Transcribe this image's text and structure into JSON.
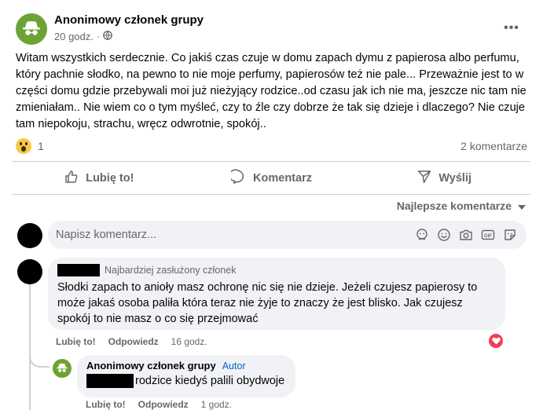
{
  "post": {
    "author": "Anonimowy członek grupy",
    "time": "20 godz.",
    "more": "•••",
    "text": "Witam wszystkich serdecznie. Co jakiś czas czuje w domu zapach dymu z papierosa albo perfumu, który pachnie słodko, na pewno  to nie moje perfumy, papierosów też nie pale... Przeważnie jest to w części domu gdzie przebywali moi już nieżyjący rodzice..od czasu jak ich nie ma, jeszcze nic tam nie zmieniałam.. Nie wiem co o tym myśleć, czy to źle czy dobrze że tak się dzieje i dlaczego? Nie czuje tam niepokoju, strachu, wręcz odwrotnie, spokój..",
    "reactions_count": "1",
    "comments_count": "2 komentarze"
  },
  "actions": {
    "like": "Lubię to!",
    "comment": "Komentarz",
    "share": "Wyślij"
  },
  "sort_label": "Najlepsze komentarze",
  "composer": {
    "placeholder": "Napisz komentarz..."
  },
  "comments": [
    {
      "badge": "Najbardziej zasłużony członek",
      "text": "Słodki zapach to anioły masz ochronę nic się nie dzieje. Jeżeli czujesz papierosy to może jakaś osoba paliła która teraz nie żyje to znaczy że jest blisko. Jak czujesz spokój to nie masz o co się przejmować",
      "like": "Lubię to!",
      "reply": "Odpowiedz",
      "time": "16 godz."
    },
    {
      "author": "Anonimowy członek grupy",
      "author_tag": "Autor",
      "text": "rodzice kiedyś palili obydwoje",
      "like": "Lubię to!",
      "reply": "Odpowiedz",
      "time": "1 godz."
    }
  ],
  "colors": {
    "accent_green": "#6da335",
    "text_secondary": "#65676b",
    "bubble_bg": "#f0f2f5",
    "heart_red": "#f33e58",
    "author_blue": "#0064d1"
  }
}
